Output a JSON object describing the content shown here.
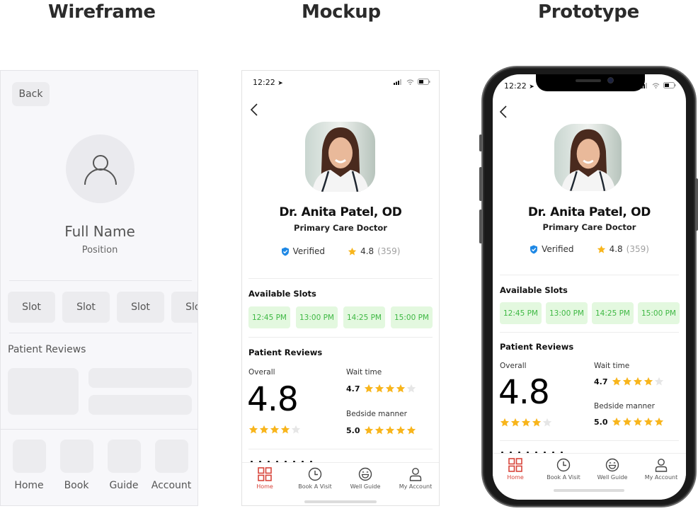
{
  "titles": {
    "wireframe": "Wireframe",
    "mockup": "Mockup",
    "prototype": "Prototype"
  },
  "wireframe": {
    "back_label": "Back",
    "avatar_icon": "user-icon",
    "name": "Full Name",
    "position": "Position",
    "slots": [
      "Slot",
      "Slot",
      "Slot",
      "Slot"
    ],
    "reviews_title": "Patient Reviews",
    "nav": [
      "Home",
      "Book",
      "Guide",
      "Account"
    ]
  },
  "profile": {
    "status_time": "12:22",
    "status_icons": [
      "location-arrow-icon",
      "signal-icon",
      "wifi-icon",
      "battery-icon"
    ],
    "back_icon": "chevron-left-icon",
    "doctor_name": "Dr. Anita Patel, OD",
    "doctor_role": "Primary Care Doctor",
    "verified_label": "Verified",
    "rating": "4.8",
    "rating_count": "(359)",
    "slots_title": "Available Slots",
    "slots": [
      "12:45 PM",
      "13:00 PM",
      "14:25 PM",
      "15:00 PM"
    ],
    "reviews_title": "Patient Reviews",
    "overall_label": "Overall",
    "overall_value": "4.8",
    "overall_stars_filled": 4,
    "wait_label": "Wait time",
    "wait_value": "4.7",
    "wait_stars_filled": 4,
    "bedside_label": "Bedside manner",
    "bedside_value": "5.0",
    "bedside_stars_filled": 5,
    "tabs": [
      {
        "label": "Home",
        "icon": "grid-icon",
        "active": true
      },
      {
        "label": "Book A Visit",
        "icon": "clock-icon",
        "active": false
      },
      {
        "label": "Well Guide",
        "icon": "smiley-icon",
        "active": false
      },
      {
        "label": "My Account",
        "icon": "user-icon",
        "active": false
      }
    ]
  },
  "colors": {
    "accent_red": "#d8453b",
    "slot_green_text": "#3fb844",
    "slot_green_bg": "#e3f8df",
    "star_gold": "#f8b51c",
    "star_empty": "#e6e6e6",
    "verified_blue": "#1e88e5"
  }
}
